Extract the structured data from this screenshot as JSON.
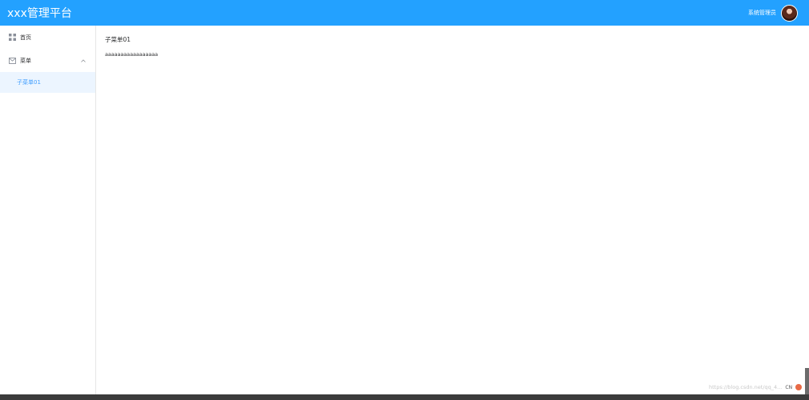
{
  "header": {
    "title": "xxx管理平台",
    "user_name": "系统管理员",
    "avatar_icon": "user-avatar",
    "background": "#23a1ff"
  },
  "sidebar": {
    "items": [
      {
        "label": "首页",
        "icon": "grid-icon"
      },
      {
        "label": "菜单",
        "icon": "mail-icon",
        "expanded": true,
        "children": [
          {
            "label": "子菜单01",
            "active": true
          }
        ]
      }
    ],
    "active_color": "#409eff",
    "active_bg": "#ecf5ff"
  },
  "main": {
    "title": "子菜单01",
    "text": "aaaaaaaaaaaaaaaaa"
  },
  "footer": {
    "ime": "CN",
    "watermark": "https://blog.csdn.net/qq_4..."
  }
}
